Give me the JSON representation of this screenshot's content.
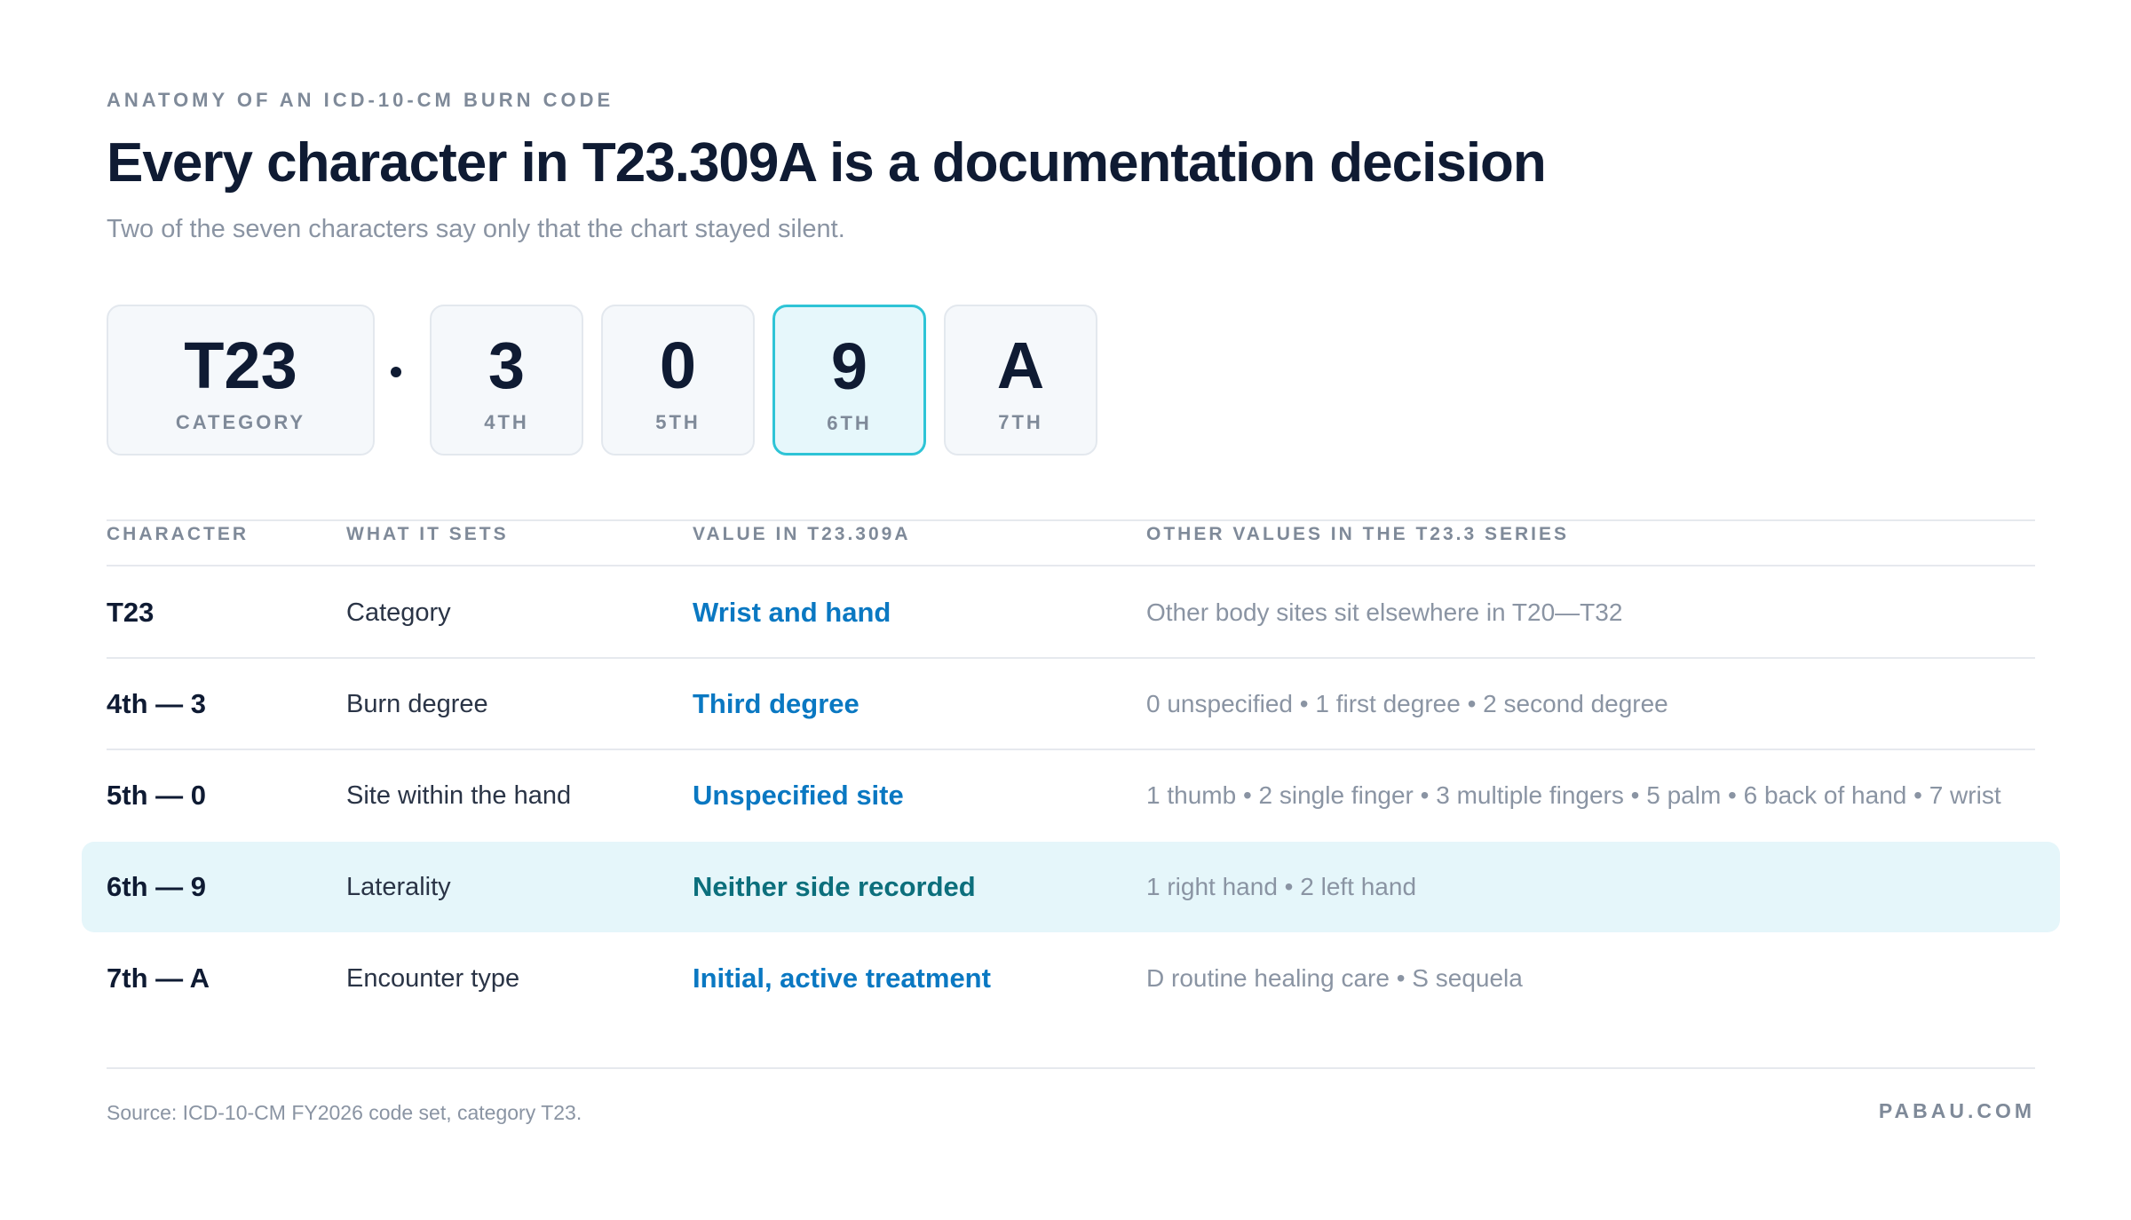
{
  "header": {
    "eyebrow": "ANATOMY OF AN ICD-10-CM BURN CODE",
    "title": "Every character in T23.309A is a documentation decision",
    "subtitle": "Two of the seven characters say only that the chart stayed silent."
  },
  "code_blocks": [
    {
      "value": "T23",
      "label": "CATEGORY",
      "highlighted": false
    },
    {
      "value": "3",
      "label": "4TH",
      "highlighted": false
    },
    {
      "value": "0",
      "label": "5TH",
      "highlighted": false
    },
    {
      "value": "9",
      "label": "6TH",
      "highlighted": true
    },
    {
      "value": "A",
      "label": "7TH",
      "highlighted": false
    }
  ],
  "table": {
    "headers": [
      "CHARACTER",
      "WHAT IT SETS",
      "VALUE IN T23.309A",
      "OTHER VALUES IN THE T23.3 SERIES"
    ],
    "rows": [
      {
        "character": "T23",
        "what": "Category",
        "value": "Wrist and hand",
        "other": "Other body sites sit elsewhere in T20—T32",
        "highlighted": false
      },
      {
        "character": "4th — 3",
        "what": "Burn degree",
        "value": "Third degree",
        "other": "0 unspecified • 1 first degree • 2 second degree",
        "highlighted": false
      },
      {
        "character": "5th — 0",
        "what": "Site within the hand",
        "value": "Unspecified site",
        "other": "1 thumb • 2 single finger • 3 multiple fingers • 5 palm • 6 back of hand • 7 wrist",
        "highlighted": false
      },
      {
        "character": "6th — 9",
        "what": "Laterality",
        "value": "Neither side recorded",
        "other": "1 right hand • 2 left hand",
        "highlighted": true
      },
      {
        "character": "7th — A",
        "what": "Encounter type",
        "value": "Initial, active treatment",
        "other": "D routine healing care • S sequela",
        "highlighted": false
      }
    ]
  },
  "footer": {
    "source": "Source: ICD-10-CM FY2026 code set, category T23.",
    "brand": "PABAU.COM"
  },
  "colors": {
    "accent_blue": "#0a78c2",
    "accent_teal": "#0c6f7c",
    "highlight_border": "#2ec4d6",
    "highlight_fill": "#e5f6fa"
  }
}
